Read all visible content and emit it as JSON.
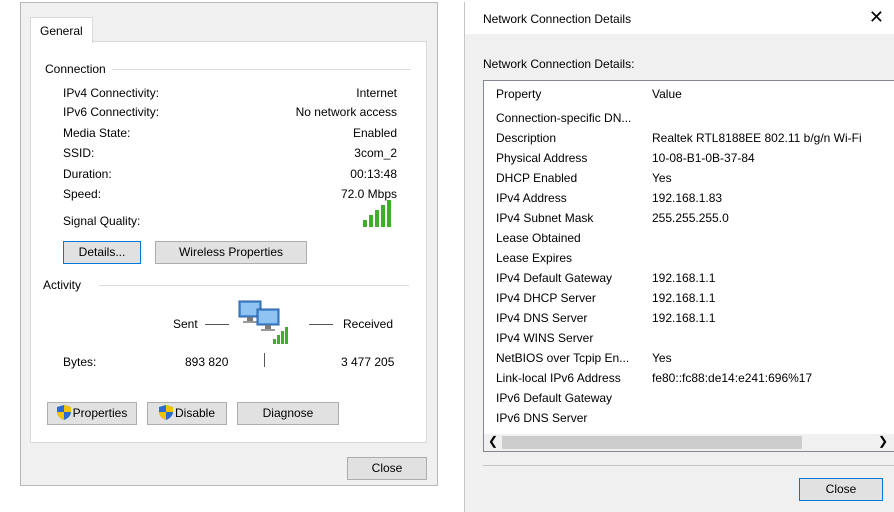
{
  "status_dialog": {
    "tab": "General",
    "connection": {
      "title": "Connection",
      "rows": [
        {
          "label": "IPv4 Connectivity:",
          "value": "Internet"
        },
        {
          "label": "IPv6 Connectivity:",
          "value": "No network access"
        },
        {
          "label": "Media State:",
          "value": "Enabled"
        },
        {
          "label": "SSID:",
          "value": "3com_2"
        },
        {
          "label": "Duration:",
          "value": "00:13:48"
        },
        {
          "label": "Speed:",
          "value": "72.0 Mbps"
        }
      ],
      "signal_label": "Signal Quality:",
      "signal_bars": 5,
      "signal_color": "#3fae2a"
    },
    "buttons": {
      "details": "Details...",
      "wireless": "Wireless Properties"
    },
    "activity": {
      "title": "Activity",
      "sent": "Sent",
      "received": "Received",
      "bytes_label": "Bytes:",
      "bytes_sent": "893 820",
      "bytes_received": "3 477 205"
    },
    "bottom_buttons": {
      "properties": "Properties",
      "disable": "Disable",
      "diagnose": "Diagnose"
    },
    "close": "Close"
  },
  "details_dialog": {
    "title": "Network Connection Details",
    "caption": "Network Connection Details:",
    "columns": {
      "property": "Property",
      "value": "Value"
    },
    "rows": [
      {
        "p": "Connection-specific DN...",
        "v": ""
      },
      {
        "p": "Description",
        "v": "Realtek RTL8188EE 802.11 b/g/n Wi-Fi"
      },
      {
        "p": "Physical Address",
        "v": "10-08-B1-0B-37-84"
      },
      {
        "p": "DHCP Enabled",
        "v": "Yes"
      },
      {
        "p": "IPv4 Address",
        "v": "192.168.1.83"
      },
      {
        "p": "IPv4 Subnet Mask",
        "v": "255.255.255.0"
      },
      {
        "p": "Lease Obtained",
        "v": ""
      },
      {
        "p": "Lease Expires",
        "v": ""
      },
      {
        "p": "IPv4 Default Gateway",
        "v": "192.168.1.1"
      },
      {
        "p": "IPv4 DHCP Server",
        "v": "192.168.1.1"
      },
      {
        "p": "IPv4 DNS Server",
        "v": "192.168.1.1"
      },
      {
        "p": "IPv4 WINS Server",
        "v": ""
      },
      {
        "p": "NetBIOS over Tcpip En...",
        "v": "Yes"
      },
      {
        "p": "Link-local IPv6 Address",
        "v": "fe80::fc88:de14:e241:696%17"
      },
      {
        "p": "IPv6 Default Gateway",
        "v": ""
      },
      {
        "p": "IPv6 DNS Server",
        "v": ""
      }
    ],
    "close": "Close"
  }
}
